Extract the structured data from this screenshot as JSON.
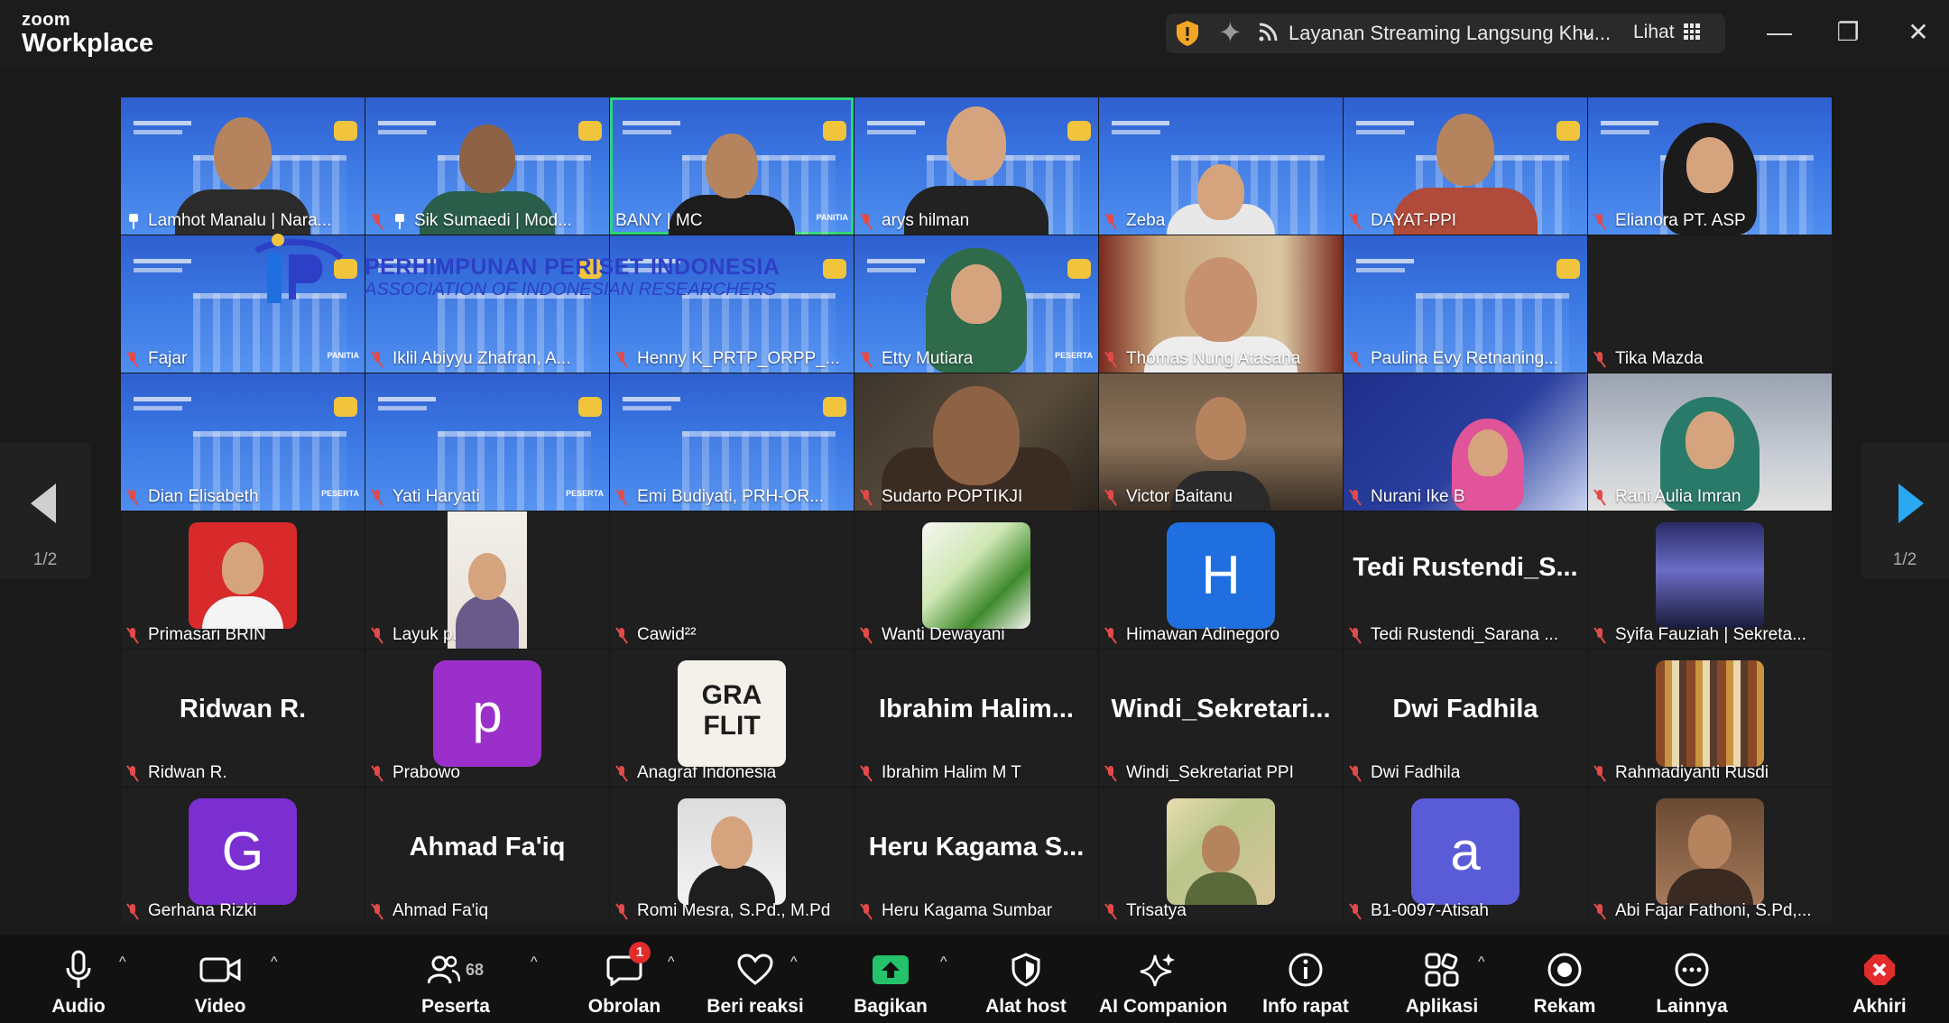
{
  "app": {
    "logo_line1": "zoom",
    "logo_line2": "Workplace"
  },
  "titlebar": {
    "stream_label": "Layanan Streaming Langsung Khu...",
    "view_label": "Lihat",
    "icons": [
      "shield-icon",
      "sparkle-icon",
      "streaming-icon",
      "chevron-down-icon",
      "grid-icon",
      "minimize-icon",
      "maximize-icon",
      "close-icon"
    ]
  },
  "watermark": {
    "line1": "PERHIMPUNAN PERISET INDONESIA",
    "line2": "ASSOCIATION OF INDONESIAN RESEARCHERS"
  },
  "tile_text": {
    "role_panitia": "PANITIA",
    "role_peserta": "PESERTA",
    "role_narasumber": "PESERT",
    "logo_text": "GRA FLIT"
  },
  "paging": {
    "left_label": "1/2",
    "right_label": "1/2"
  },
  "participants": [
    {
      "name": "Lamhot Manalu | Nara...",
      "pinned": true
    },
    {
      "name": "Sik Sumaedi | Mod...",
      "pinned": true
    },
    {
      "name": "BANY | MC",
      "active": true
    },
    {
      "name": "arys hilman"
    },
    {
      "name": "Zeba"
    },
    {
      "name": "DAYAT-PPI"
    },
    {
      "name": "Elianora PT. ASP"
    },
    {
      "name": "Fajar"
    },
    {
      "name": "Iklil Abiyyu Zhafran, A..."
    },
    {
      "name": "Henny K_PRTP_ORPP_..."
    },
    {
      "name": "Etty Mutiara"
    },
    {
      "name": "Thomas Nung Atasana"
    },
    {
      "name": "Paulina Evy Retnaning..."
    },
    {
      "name": "Tika Mazda"
    },
    {
      "name": "Dian Elisabeth"
    },
    {
      "name": "Yati Haryati"
    },
    {
      "name": "Emi Budiyati, PRH-OR..."
    },
    {
      "name": "Sudarto POPTIKJI"
    },
    {
      "name": "Victor Baitanu"
    },
    {
      "name": "Nurani Ike B"
    },
    {
      "name": "Rani Aulia Imran"
    },
    {
      "name": "Primasari BRIN"
    },
    {
      "name": "Layuk p."
    },
    {
      "name": "Cawid²²"
    },
    {
      "name": "Wanti Dewayani"
    },
    {
      "name": "Himawan Adinegoro",
      "avatar_letter": "H"
    },
    {
      "name": "Tedi Rustendi_Sarana ...",
      "display_name": "Tedi  Rustendi_S..."
    },
    {
      "name": "Syifa Fauziah | Sekreta..."
    },
    {
      "name": "Ridwan R.",
      "display_name": "Ridwan R."
    },
    {
      "name": "Prabowo",
      "avatar_letter": "p"
    },
    {
      "name": "Anagraf Indonesia"
    },
    {
      "name": "Ibrahim Halim M T",
      "display_name": "Ibrahim  Halim..."
    },
    {
      "name": "Windi_Sekretariat PPI",
      "display_name": "Windi_Sekretari..."
    },
    {
      "name": "Dwi Fadhila",
      "display_name": "Dwi Fadhila"
    },
    {
      "name": "Rahmadiyanti Rusdi"
    },
    {
      "name": "Gerhana Rizki",
      "avatar_letter": "G"
    },
    {
      "name": "Ahmad Fa'iq",
      "display_name": "Ahmad Fa'iq"
    },
    {
      "name": "Romi Mesra, S.Pd., M.Pd"
    },
    {
      "name": "Heru Kagama Sumbar",
      "display_name": "Heru  Kagama  S..."
    },
    {
      "name": "Trisatya"
    },
    {
      "name": "B1-0097-Atisah",
      "avatar_letter": "a"
    },
    {
      "name": "Abi Fajar Fathoni, S.Pd,..."
    }
  ],
  "toolbar": {
    "audio": "Audio",
    "video": "Video",
    "participants": "Peserta",
    "participants_count": "68",
    "chat": "Obrolan",
    "chat_badge": "1",
    "react": "Beri reaksi",
    "share": "Bagikan",
    "host_tools": "Alat host",
    "ai": "AI Companion",
    "info": "Info rapat",
    "apps": "Aplikasi",
    "record": "Rekam",
    "more": "Lainnya",
    "end": "Akhiri"
  },
  "colors": {
    "accent_green": "#2fd37a",
    "share_green": "#23c26b",
    "mute_red": "#e24a4a",
    "end_red": "#e22b2b",
    "nav_arrow_blue": "#2aa8f0"
  }
}
